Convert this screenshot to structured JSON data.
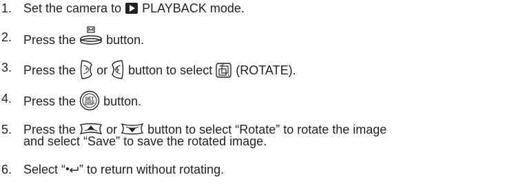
{
  "steps": [
    {
      "number": "1.",
      "before": "Set the camera to",
      "icon": "playback-icon",
      "after": "PLAYBACK mode."
    },
    {
      "number": "2.",
      "before": "Press the",
      "icon": "menu-button-icon",
      "icon_label": "M",
      "after": "button."
    },
    {
      "number": "3.",
      "before": "Press the",
      "icon1": "left-button-icon",
      "middle": "or",
      "icon2": "right-button-icon",
      "after": "button to select",
      "icon3": "rotate-icon",
      "after2": "(ROTATE)."
    },
    {
      "number": "4.",
      "before": "Press the",
      "icon": "set-disp-button-icon",
      "icon_label_top": "SET",
      "icon_label_bottom": "DISP",
      "after": "button."
    },
    {
      "number": "5.",
      "before": "Press the",
      "icon1": "up-button-icon",
      "middle": "or",
      "icon2": "down-button-icon",
      "after": "button to select “Rotate” to rotate the image",
      "line2": "and select “Save” to save the rotated image."
    },
    {
      "number": "6.",
      "text": "Select “•⮐” to return without rotating.",
      "before": "Select “",
      "icon": "return-icon",
      "after": "” to return without rotating."
    }
  ]
}
